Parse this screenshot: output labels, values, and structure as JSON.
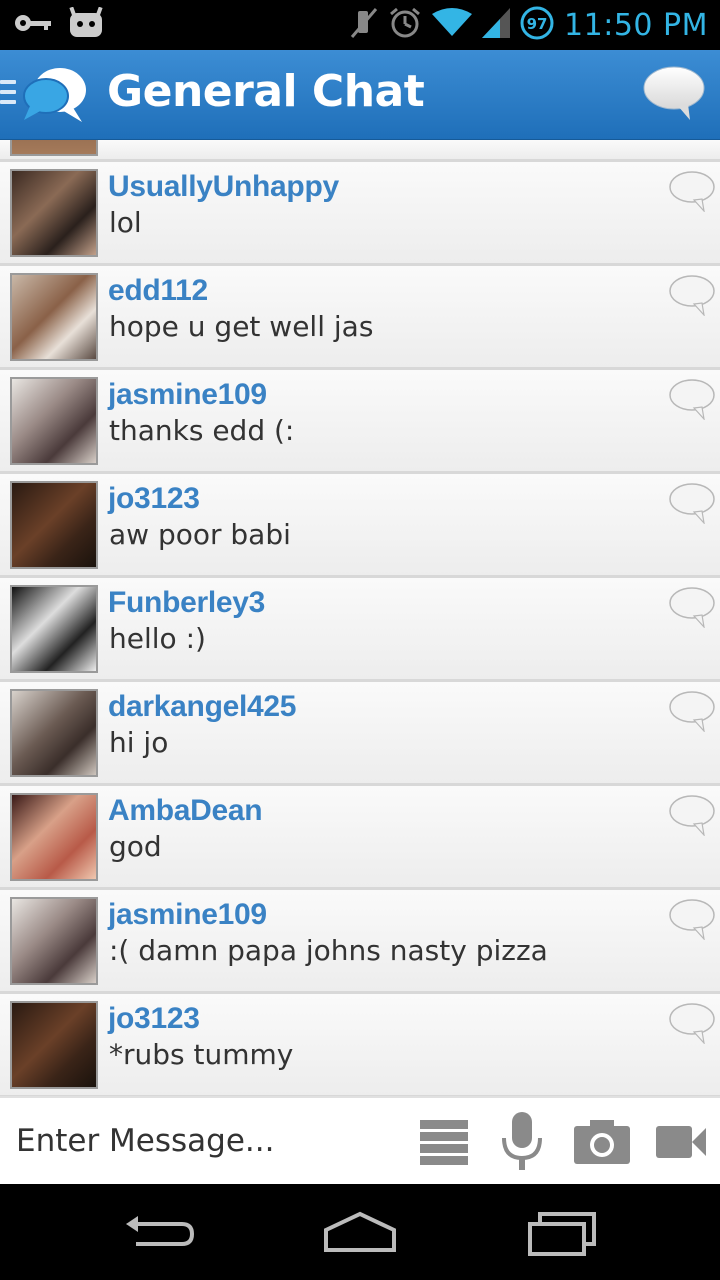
{
  "status_bar": {
    "time": "11:50 PM",
    "battery_level": "97",
    "icons": [
      "key-icon",
      "android-icon",
      "mute-icon",
      "alarm-icon",
      "wifi-icon",
      "signal-icon",
      "battery-icon"
    ]
  },
  "action_bar": {
    "title": "General Chat",
    "icons": [
      "menu-icon",
      "app-logo-icon",
      "new-chat-icon"
    ],
    "colors": {
      "bar": "#2a7cc7",
      "title": "#ffffff"
    }
  },
  "messages": [
    {
      "username": "UsuallyUnhappy",
      "text": "lol",
      "avatar": "group-photo"
    },
    {
      "username": "edd112",
      "text": "hope u get well jas",
      "avatar": "edd-photo"
    },
    {
      "username": "jasmine109",
      "text": "thanks edd (:",
      "avatar": "jasmine-photo"
    },
    {
      "username": "jo3123",
      "text": "aw poor babi",
      "avatar": "jo-photo"
    },
    {
      "username": "Funberley3",
      "text": "hello :)",
      "avatar": "funberley-photo"
    },
    {
      "username": "darkangel425",
      "text": "hi jo",
      "avatar": "darkangel-photo"
    },
    {
      "username": "AmbaDean",
      "text": "god",
      "avatar": "ambadean-photo"
    },
    {
      "username": "jasmine109",
      "text": ":( damn papa johns nasty pizza",
      "avatar": "jasmine-photo"
    },
    {
      "username": "jo3123",
      "text": "*rubs tummy",
      "avatar": "jo-photo"
    }
  ],
  "input_bar": {
    "placeholder": "Enter Message...",
    "icons": [
      "list-icon",
      "microphone-icon",
      "camera-icon",
      "video-icon"
    ]
  },
  "nav_bar": {
    "icons": [
      "back-icon",
      "home-icon",
      "recent-apps-icon"
    ]
  },
  "colors": {
    "username": "#3a82c4",
    "message_text": "#333333",
    "status_accent": "#33b5e5"
  }
}
